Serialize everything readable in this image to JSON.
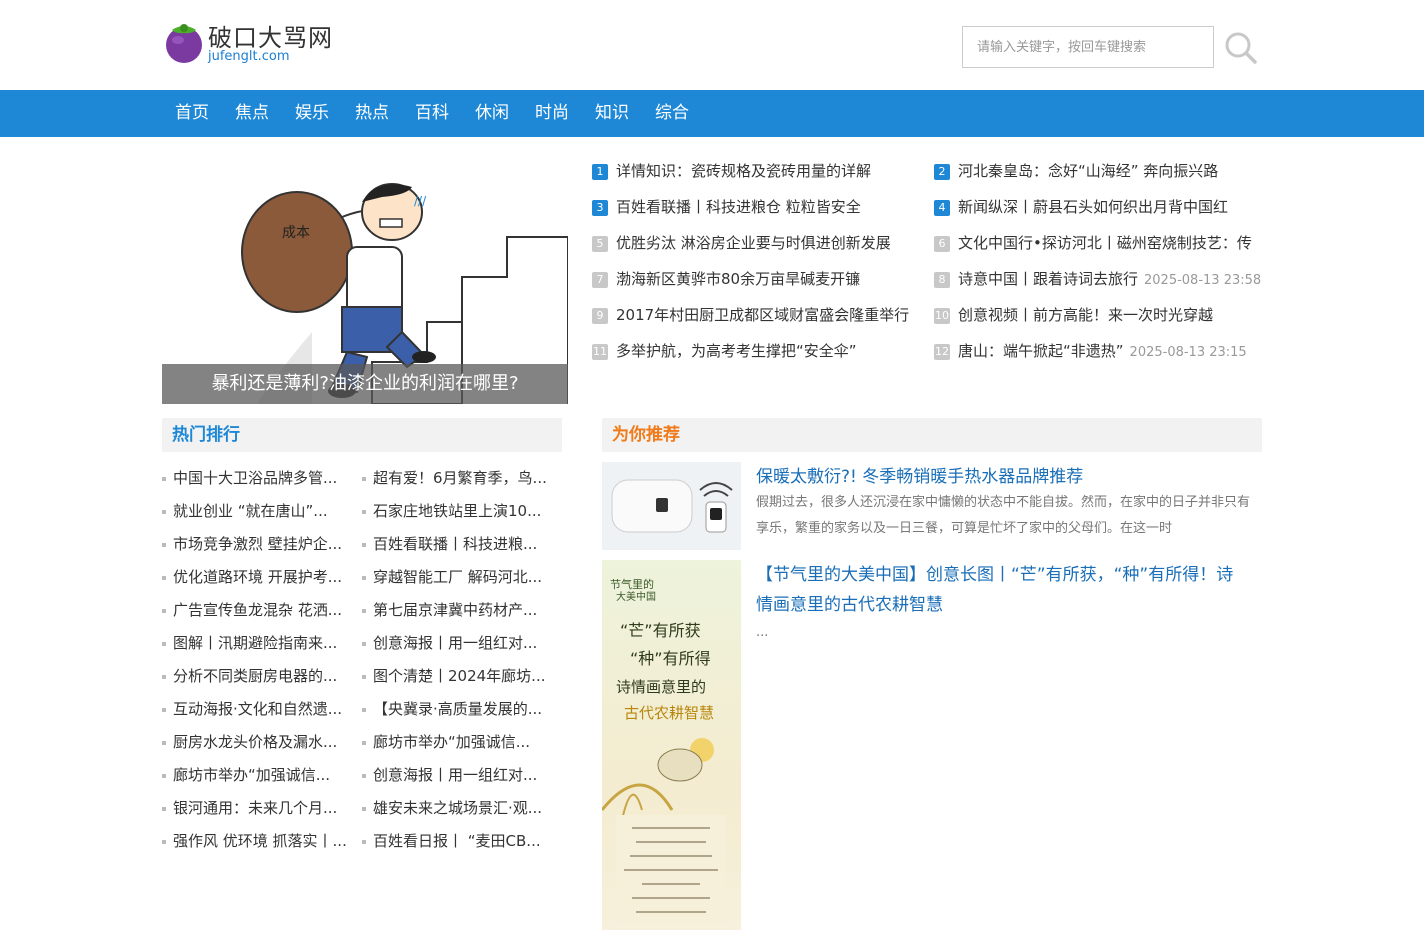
{
  "site": {
    "name": "破口大骂网",
    "domain": "jufenglt.com"
  },
  "search": {
    "placeholder": "请输入关键字，按回车键搜索"
  },
  "nav": [
    "首页",
    "焦点",
    "娱乐",
    "热点",
    "百科",
    "休闲",
    "时尚",
    "知识",
    "综合"
  ],
  "hero": {
    "caption": "暴利还是薄利?油漆企业的利润在哪里?",
    "sack_text": "成本"
  },
  "news": [
    {
      "num": "1",
      "title": "详情知识：瓷砖规格及瓷砖用量的详解",
      "date": ""
    },
    {
      "num": "2",
      "title": "河北秦皇岛：念好“山海经” 奔向振兴路",
      "date": ""
    },
    {
      "num": "3",
      "title": "百姓看联播丨科技进粮仓 粒粒皆安全",
      "date": ""
    },
    {
      "num": "4",
      "title": "新闻纵深丨蔚县石头如何织出月背中国红",
      "date": ""
    },
    {
      "num": "5",
      "title": "优胜劣汰 淋浴房企业要与时俱进创新发展",
      "date": ""
    },
    {
      "num": "6",
      "title": "文化中国行•探访河北丨磁州窑烧制技艺：传",
      "date": ""
    },
    {
      "num": "7",
      "title": "渤海新区黄骅市80余万亩旱碱麦开镰",
      "date": ""
    },
    {
      "num": "8",
      "title": "诗意中国丨跟着诗词去旅行",
      "date": "2025-08-13 23:58"
    },
    {
      "num": "9",
      "title": "2017年村田厨卫成都区域财富盛会隆重举行",
      "date": ""
    },
    {
      "num": "10",
      "title": "创意视频丨前方高能！来一次时光穿越",
      "date": ""
    },
    {
      "num": "11",
      "title": "多举护航，为高考考生撑把“安全伞”",
      "date": ""
    },
    {
      "num": "12",
      "title": "唐山：端午掀起“非遗热”",
      "date": "2025-08-13 23:15"
    }
  ],
  "hot": {
    "heading": "热门排行",
    "rows": [
      [
        "中国十大卫浴品牌多管...",
        "超有爱！6月繁育季，鸟..."
      ],
      [
        "就业创业 “就在唐山”...",
        "石家庄地铁站里上演10..."
      ],
      [
        "市场竞争激烈 壁挂炉企...",
        "百姓看联播丨科技进粮..."
      ],
      [
        "优化道路环境 开展护考...",
        "穿越智能工厂 解码河北..."
      ],
      [
        "广告宣传鱼龙混杂 花洒...",
        "第七届京津冀中药材产..."
      ],
      [
        "图解丨汛期避险指南来...",
        "创意海报丨用一组红对..."
      ],
      [
        "分析不同类厨房电器的...",
        "图个清楚丨2024年廊坊..."
      ],
      [
        "互动海报·文化和自然遗...",
        "【央冀录·高质量发展的..."
      ],
      [
        "厨房水龙头价格及漏水...",
        "廊坊市举办“加强诚信..."
      ],
      [
        "廊坊市举办“加强诚信...",
        "创意海报丨用一组红对..."
      ],
      [
        "银河通用：未来几个月...",
        "雄安未来之城场景汇·观..."
      ],
      [
        "强作风 优环境 抓落实丨...",
        "百姓看日报丨 “麦田CB..."
      ]
    ]
  },
  "recommend": {
    "heading": "为你推荐",
    "items": [
      {
        "title": "保暖太敷衍?! 冬季畅销暖手热水器品牌推荐",
        "desc": "假期过去，很多人还沉浸在家中慵懒的状态中不能自拔。然而，在家中的日子并非只有享乐，繁重的家务以及一日三餐，可算是忙坏了家中的父母们。在这一时"
      },
      {
        "title": "【节气里的大美中国】创意长图丨“芒”有所获，“种”有所得！诗情画意里的古代农耕智慧",
        "desc": "...",
        "poster_lines": [
          "节气里的",
          "大美中国",
          "“芒”有所获",
          "“种”有所得",
          "诗情画意里的",
          "古代农耕智慧"
        ]
      }
    ]
  },
  "colors": {
    "nav_bg": "#1e88d6",
    "accent_blue": "#1e88d6",
    "accent_orange": "#f07b1a",
    "link_blue": "#1a6eb8"
  }
}
